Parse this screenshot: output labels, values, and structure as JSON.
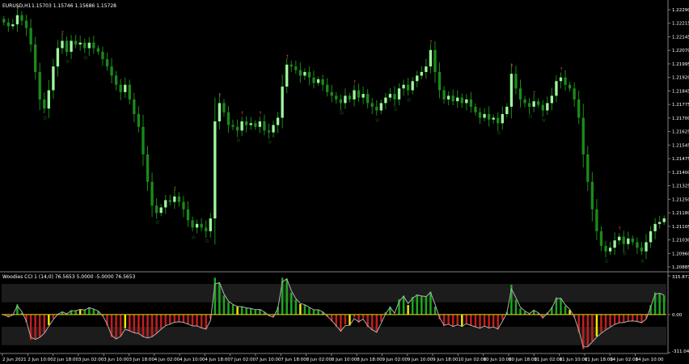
{
  "main_chart": {
    "symbol_label": "EURUSD,H1",
    "ohlc_label": "1.15703 1.15746 1.15686 1.15728",
    "price_axis_ticks": [
      "1.22290",
      "1.22215",
      "1.22145",
      "1.22070",
      "1.21995",
      "1.21920",
      "1.21845",
      "1.21775",
      "1.21700",
      "1.21625",
      "1.21545",
      "1.21475",
      "1.21400",
      "1.21325",
      "1.21250",
      "1.21180",
      "1.21105",
      "1.21030",
      "1.20960",
      "1.20885"
    ],
    "price_range": [
      1.20885,
      1.2229
    ],
    "colors": {
      "background": "#000000",
      "bull_candle": "#9ff59f",
      "bear_candle": "#1a8a1a",
      "wick": "#1a8a1a",
      "arrow_star": "#2e9e2e",
      "arrow_up_red": "#e23b3b"
    }
  },
  "indicator": {
    "title_label": "Woodies CCI 1 (14,0) 76.5653 5.0000 -5.0000 76.5653",
    "axis_ticks": [
      "315.8771",
      "0.00",
      "-311.0446"
    ],
    "axis_range": [
      -311.0446,
      315.8771
    ],
    "colors": {
      "band": "#1c1c1c",
      "positive_bar": "#1ea81e",
      "negative_bar": "#c41e1e",
      "neutral_bar": "#f2e600",
      "cci_line": "#b0b0b0",
      "zero_line": "#f2e600"
    }
  },
  "time_axis": {
    "labels": [
      "2 Jun 2021",
      "2 Jun 10:00",
      "2 Jun 18:00",
      "3 Jun 02:00",
      "3 Jun 10:00",
      "3 Jun 18:00",
      "4 Jun 02:00",
      "4 Jun 10:00",
      "4 Jun 18:00",
      "7 Jun 02:00",
      "7 Jun 10:00",
      "7 Jun 18:00",
      "8 Jun 02:00",
      "8 Jun 10:00",
      "8 Jun 18:00",
      "9 Jun 02:00",
      "9 Jun 10:00",
      "9 Jun 18:00",
      "10 Jun 02:00",
      "10 Jun 10:00",
      "10 Jun 18:00",
      "11 Jun 02:00",
      "11 Jun 10:00",
      "11 Jun 18:00",
      "14 Jun 02:00",
      "14 Jun 10:00"
    ]
  },
  "chart_data": {
    "type": "candlestick",
    "closes": [
      1.2222,
      1.222,
      1.2221,
      1.2226,
      1.2223,
      1.2219,
      1.221,
      1.2195,
      1.218,
      1.2175,
      1.2185,
      1.2198,
      1.2208,
      1.2212,
      1.2206,
      1.2212,
      1.221,
      1.2211,
      1.2208,
      1.2211,
      1.2208,
      1.2206,
      1.2202,
      1.2198,
      1.2193,
      1.2188,
      1.2184,
      1.2188,
      1.218,
      1.2172,
      1.2165,
      1.215,
      1.2135,
      1.2122,
      1.2118,
      1.2121,
      1.2125,
      1.2124,
      1.2127,
      1.2124,
      1.212,
      1.2114,
      1.211,
      1.2112,
      1.211,
      1.2108,
      1.2115,
      1.2168,
      1.2178,
      1.2173,
      1.2166,
      1.2165,
      1.2163,
      1.2168,
      1.2166,
      1.2167,
      1.2165,
      1.2168,
      1.2163,
      1.2162,
      1.2166,
      1.217,
      1.2187,
      1.2199,
      1.2198,
      1.2196,
      1.2193,
      1.2195,
      1.2192,
      1.2189,
      1.2191,
      1.2188,
      1.2184,
      1.2182,
      1.218,
      1.2178,
      1.2182,
      1.218,
      1.2185,
      1.2181,
      1.2183,
      1.2178,
      1.2176,
      1.2174,
      1.2178,
      1.2181,
      1.2183,
      1.218,
      1.2186,
      1.2188,
      1.2185,
      1.219,
      1.2193,
      1.2195,
      1.2198,
      1.2207,
      1.2195,
      1.2185,
      1.218,
      1.2182,
      1.2179,
      1.2181,
      1.2178,
      1.218,
      1.2176,
      1.2173,
      1.217,
      1.2172,
      1.2169,
      1.217,
      1.2167,
      1.2172,
      1.2176,
      1.2194,
      1.2186,
      1.218,
      1.2178,
      1.2176,
      1.2179,
      1.2177,
      1.2174,
      1.2178,
      1.2182,
      1.219,
      1.2192,
      1.2188,
      1.2186,
      1.218,
      1.217,
      1.215,
      1.2135,
      1.212,
      1.2108,
      1.21,
      1.2097,
      1.2099,
      1.2103,
      1.2105,
      1.2101,
      1.2104,
      1.2102,
      1.2099,
      1.2097,
      1.2102,
      1.2108,
      1.2112,
      1.2113,
      1.2115
    ]
  }
}
